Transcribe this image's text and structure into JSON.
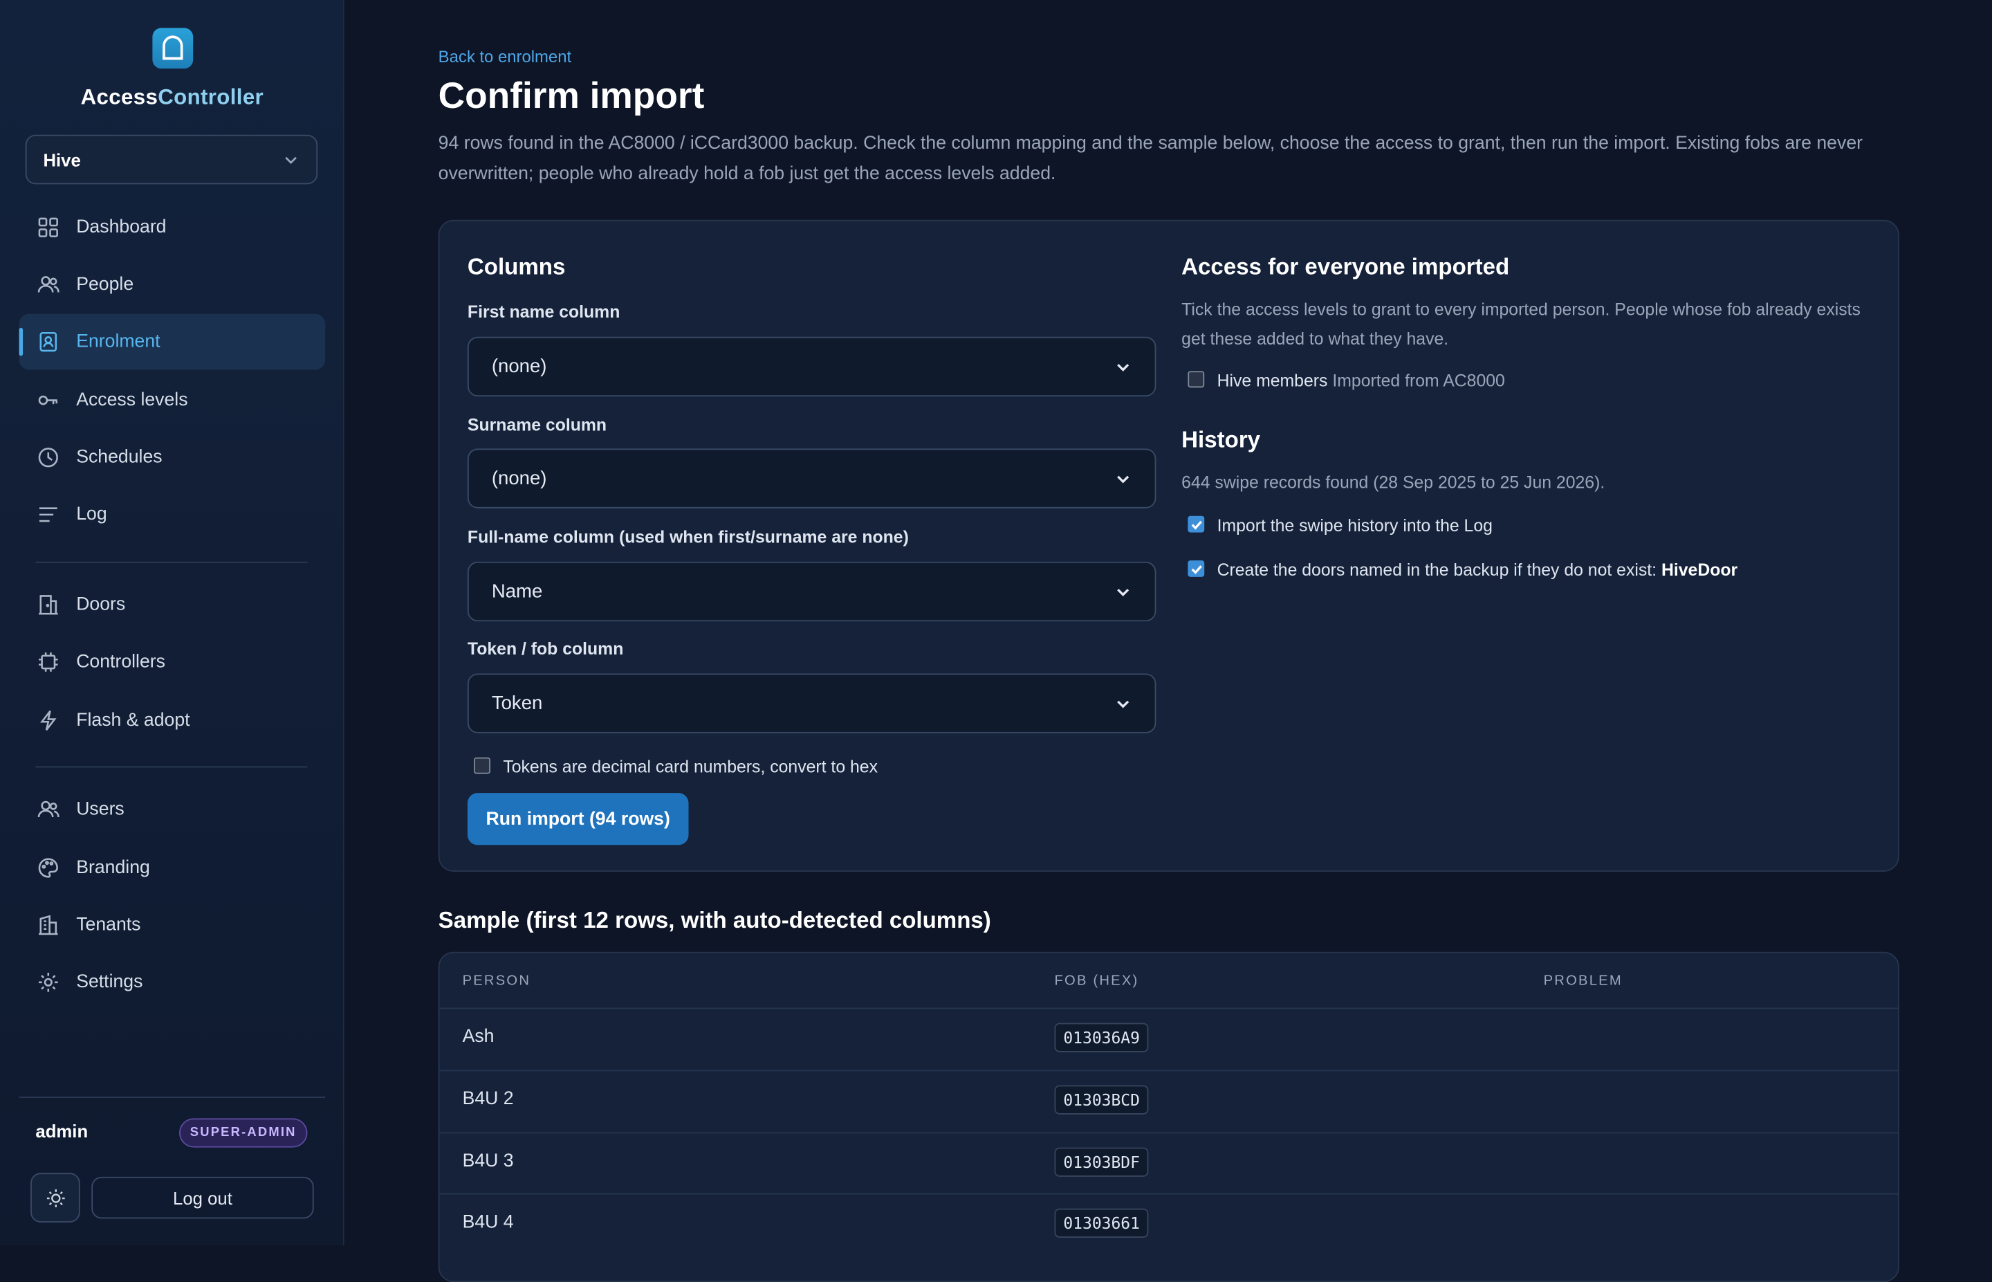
{
  "app": {
    "name_part1": "Access",
    "name_part2": "Controller"
  },
  "tenant_select": {
    "value": "Hive"
  },
  "nav": {
    "items": [
      {
        "label": "Dashboard",
        "icon": "dashboard-icon"
      },
      {
        "label": "People",
        "icon": "people-icon"
      },
      {
        "label": "Enrolment",
        "icon": "enrolment-icon",
        "active": true
      },
      {
        "label": "Access levels",
        "icon": "key-icon"
      },
      {
        "label": "Schedules",
        "icon": "clock-icon"
      },
      {
        "label": "Log",
        "icon": "log-icon"
      },
      {
        "label": "Doors",
        "icon": "door-icon"
      },
      {
        "label": "Controllers",
        "icon": "chip-icon"
      },
      {
        "label": "Flash & adopt",
        "icon": "lightning-icon"
      },
      {
        "label": "Users",
        "icon": "users-icon"
      },
      {
        "label": "Branding",
        "icon": "palette-icon"
      },
      {
        "label": "Tenants",
        "icon": "building-icon"
      },
      {
        "label": "Settings",
        "icon": "gear-icon"
      }
    ]
  },
  "user": {
    "name": "admin",
    "role": "SUPER-ADMIN",
    "logout_label": "Log out"
  },
  "page": {
    "back_link": "Back to enrolment",
    "title": "Confirm import",
    "description": "94 rows found in the AC8000 / iCCard3000 backup. Check the column mapping and the sample below, choose the access to grant, then run the import. Existing fobs are never overwritten; people who already hold a fob just get the access levels added."
  },
  "columns": {
    "title": "Columns",
    "first_name": {
      "label": "First name column",
      "value": "(none)"
    },
    "surname": {
      "label": "Surname column",
      "value": "(none)"
    },
    "full_name": {
      "label": "Full-name column (used when first/surname are none)",
      "value": "Name"
    },
    "token": {
      "label": "Token / fob column",
      "value": "Token"
    },
    "decimal_checkbox": {
      "label": "Tokens are decimal card numbers, convert to hex",
      "checked": false
    },
    "run_button": "Run import (94 rows)"
  },
  "access": {
    "title": "Access for everyone imported",
    "description": "Tick the access levels to grant to every imported person. People whose fob already exists get these added to what they have.",
    "levels": [
      {
        "name": "Hive members",
        "note": "Imported from AC8000",
        "checked": false
      }
    ]
  },
  "history": {
    "title": "History",
    "summary": "644 swipe records found (28 Sep 2025 to 25 Jun 2026).",
    "import_swipes": {
      "label": "Import the swipe history into the Log",
      "checked": true
    },
    "create_doors": {
      "label": "Create the doors named in the backup if they do not exist:",
      "doors": "HiveDoor",
      "checked": true
    }
  },
  "sample": {
    "title": "Sample (first 12 rows, with auto-detected columns)",
    "headers": {
      "person": "PERSON",
      "fob": "FOB (HEX)",
      "problem": "PROBLEM"
    },
    "rows": [
      {
        "person": "Ash",
        "fob": "013036A9",
        "problem": ""
      },
      {
        "person": "B4U 2",
        "fob": "01303BCD",
        "problem": ""
      },
      {
        "person": "B4U 3",
        "fob": "01303BDF",
        "problem": ""
      },
      {
        "person": "B4U 4",
        "fob": "01303661",
        "problem": ""
      }
    ]
  },
  "colors": {
    "accent": "#4ea6e8",
    "primary_button": "#1f73bd",
    "background": "#0d1526",
    "card": "#15223a"
  }
}
